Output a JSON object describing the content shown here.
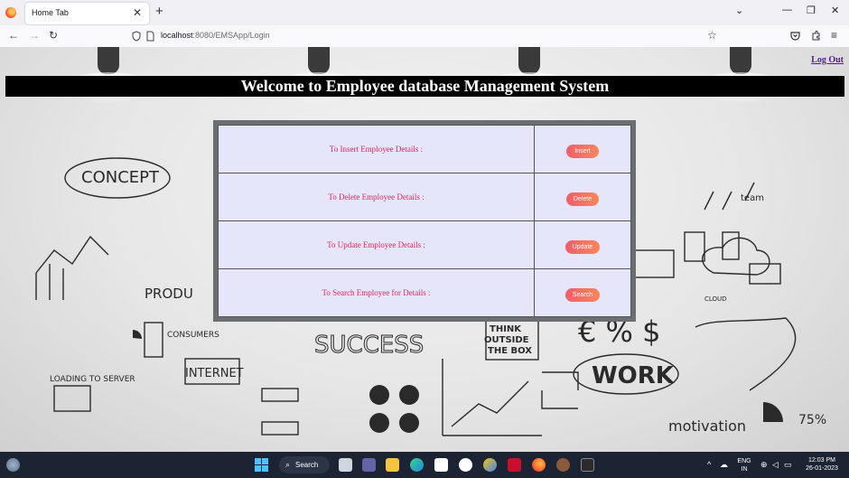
{
  "browser": {
    "tab_title": "Home Tab",
    "tab_close": "✕",
    "new_tab": "+",
    "url_host": "localhost",
    "url_path": ":8080/EMSApp/Login",
    "window_controls": {
      "chevron": "⌄",
      "minimize": "—",
      "restore": "❐",
      "close": "✕"
    },
    "nav": {
      "back": "←",
      "forward": "→",
      "reload": "↻",
      "star": "☆",
      "menu": "≡"
    }
  },
  "page": {
    "logout_label": "Log Out",
    "banner_title": "Welcome to Employee database Management System",
    "rows": [
      {
        "label": "To Insert Employee Details :",
        "button": "Insert"
      },
      {
        "label": "To Delete Employee Details :",
        "button": "Delete"
      },
      {
        "label": "To Update Employee Details :",
        "button": "Update"
      },
      {
        "label": "To Search Employee for Details :",
        "button": "Search"
      }
    ],
    "background_text": {
      "concept": "CONCEPT",
      "success": "SUCCESS",
      "work": "WORK",
      "think": "THINK",
      "outside": "OUTSIDE",
      "the_box": "THE BOX",
      "motivation": "motivation",
      "internet": "INTERNET",
      "consumers": "CONSUMERS",
      "loading": "LOADING TO SERVER",
      "cloud": "CLOUD",
      "team": "team",
      "percent": "€ % $",
      "products": "PRODU",
      "seventy_five": "75%"
    }
  },
  "taskbar": {
    "search_label": "Search",
    "lang_line1": "ENG",
    "lang_line2": "IN",
    "time": "12:03 PM",
    "date": "26-01-2023"
  },
  "colors": {
    "banner_bg": "#000000",
    "label_text": "#e0245e",
    "table_bg": "#e6e6fa",
    "button_start": "#f25d6b",
    "button_end": "#f8875b",
    "logout_link": "#551a8b"
  }
}
